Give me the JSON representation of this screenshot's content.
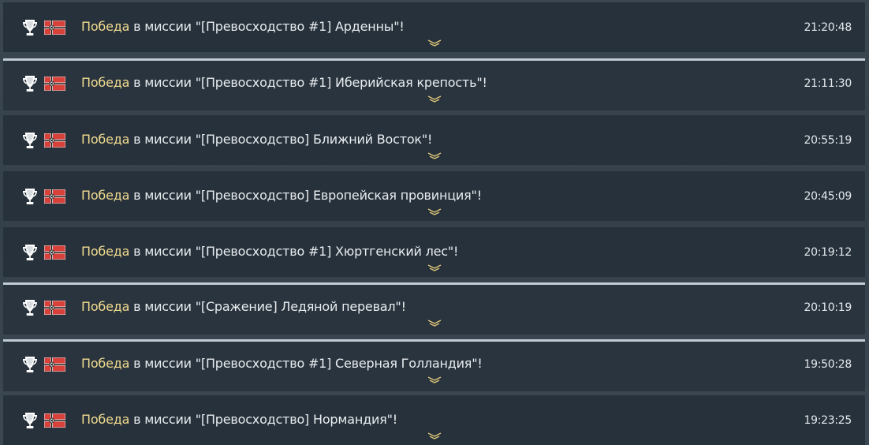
{
  "entries": [
    {
      "victory": "Победа",
      "text": " в миссии \"[Превосходство #1] Арденны\"!",
      "time": "21:20:48",
      "highlight": false
    },
    {
      "victory": "Победа",
      "text": " в миссии \"[Превосходство #1] Иберийская крепость\"!",
      "time": "21:11:30",
      "highlight": true
    },
    {
      "victory": "Победа",
      "text": " в миссии \"[Превосходство] Ближний Восток\"!",
      "time": "20:55:19",
      "highlight": false
    },
    {
      "victory": "Победа",
      "text": " в миссии \"[Превосходство] Европейская провинция\"!",
      "time": "20:45:09",
      "highlight": false
    },
    {
      "victory": "Победа",
      "text": " в миссии \"[Превосходство #1] Хюртгенский лес\"!",
      "time": "20:19:12",
      "highlight": false
    },
    {
      "victory": "Победа",
      "text": " в миссии \"[Сражение] Ледяной перевал\"!",
      "time": "20:10:19",
      "highlight": true
    },
    {
      "victory": "Победа",
      "text": " в миссии \"[Превосходство #1] Северная Голландия\"!",
      "time": "19:50:28",
      "highlight": true
    },
    {
      "victory": "Победа",
      "text": " в миссии \"[Превосходство] Нормандия\"!",
      "time": "19:23:25",
      "highlight": false
    }
  ],
  "icons": {
    "trophy": "trophy-icon",
    "flag": "germany-flag-icon",
    "expand": "expand-chevron-icon"
  },
  "colors": {
    "victory_text": "#f2dc8f",
    "row_background": "#27313b",
    "highlight_border": "#c0cbd3"
  }
}
